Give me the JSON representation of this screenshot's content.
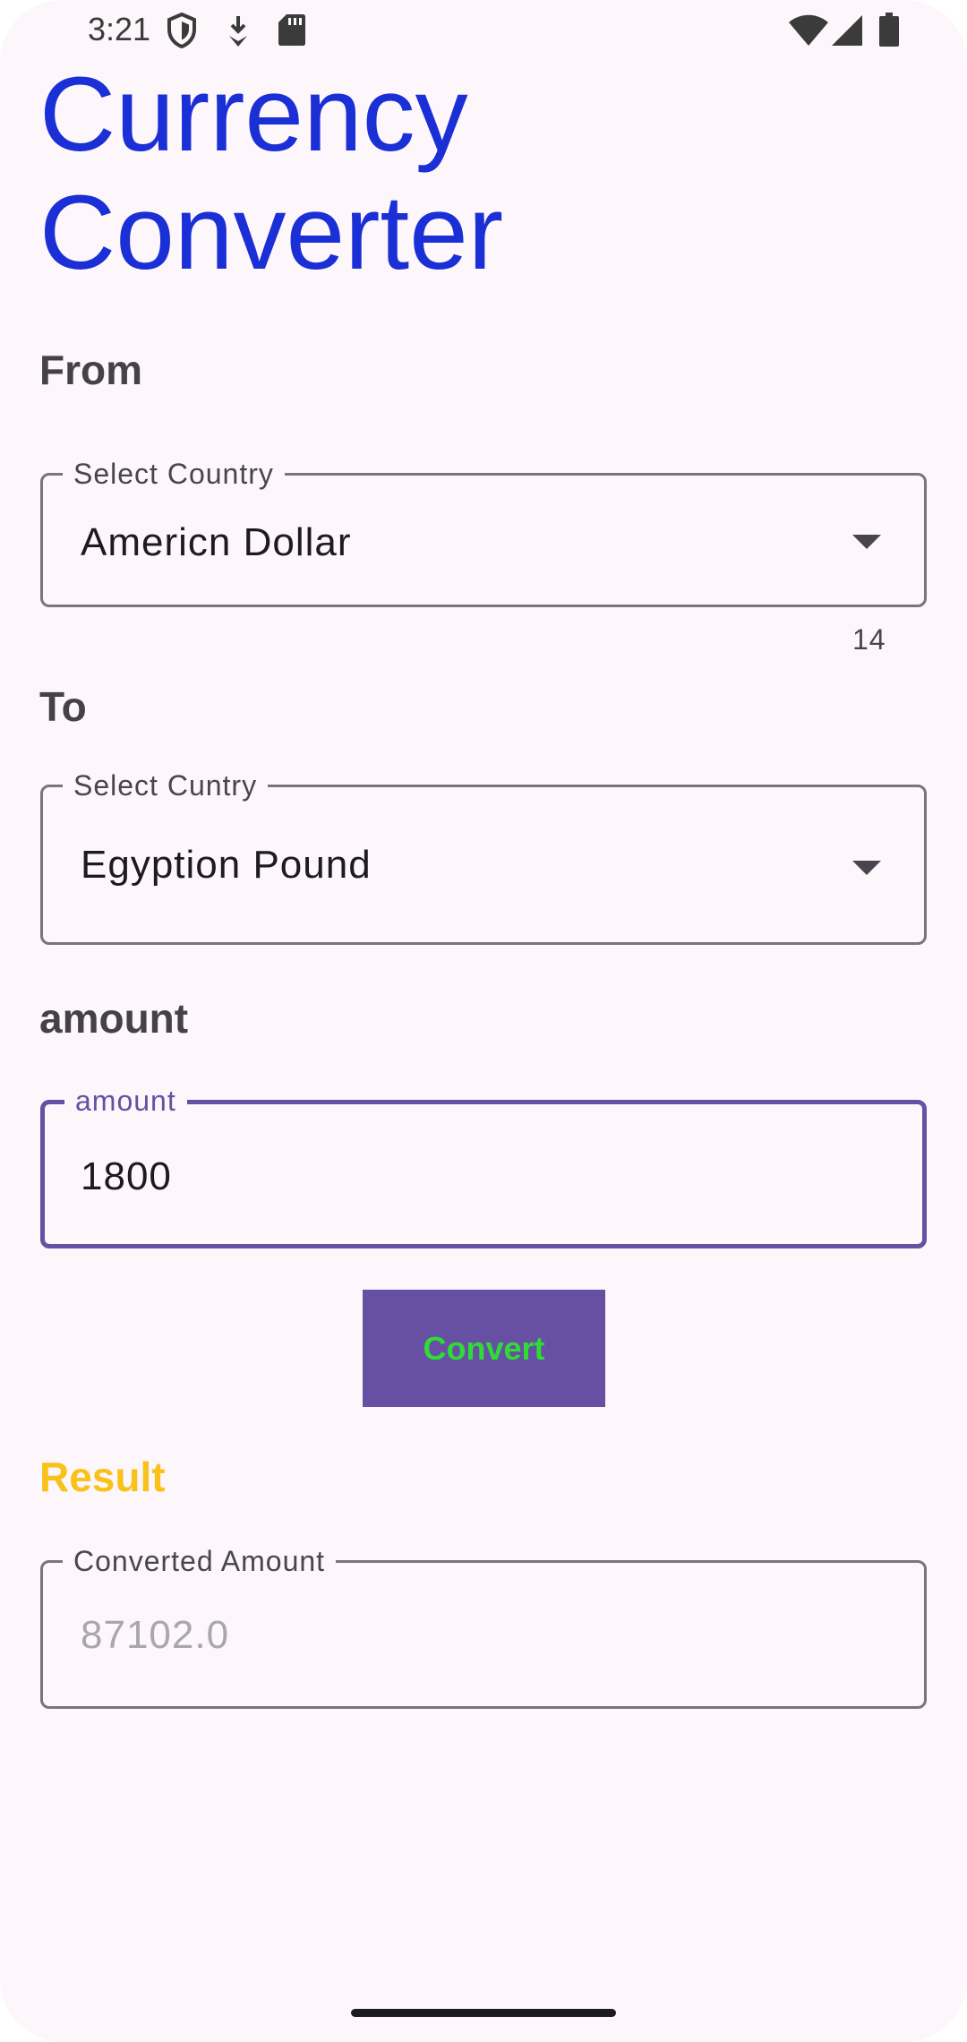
{
  "status_bar": {
    "time": "3:21",
    "icons": [
      "shield-icon",
      "download-icon",
      "sd-card-icon",
      "wifi-icon",
      "signal-icon",
      "battery-icon"
    ]
  },
  "title": {
    "line1": "Currency",
    "line2": "Converter"
  },
  "from": {
    "section_label": "From",
    "field_label": "Select Country",
    "selected_value": "Americn Dollar",
    "counter": "14"
  },
  "to": {
    "section_label": "To",
    "field_label": "Select Cuntry",
    "selected_value": "Egyption Pound"
  },
  "amount": {
    "section_label": "amount",
    "field_label": "amount",
    "value": "1800"
  },
  "convert_button": {
    "label": "Convert"
  },
  "result": {
    "section_label": "Result",
    "field_label": "Converted Amount",
    "value": "87102.0"
  },
  "colors": {
    "title": "#1a2fd6",
    "primary": "#6750a4",
    "button_text": "#2fdc33",
    "result_label": "#f8c21a",
    "background": "#fdf6fb"
  }
}
